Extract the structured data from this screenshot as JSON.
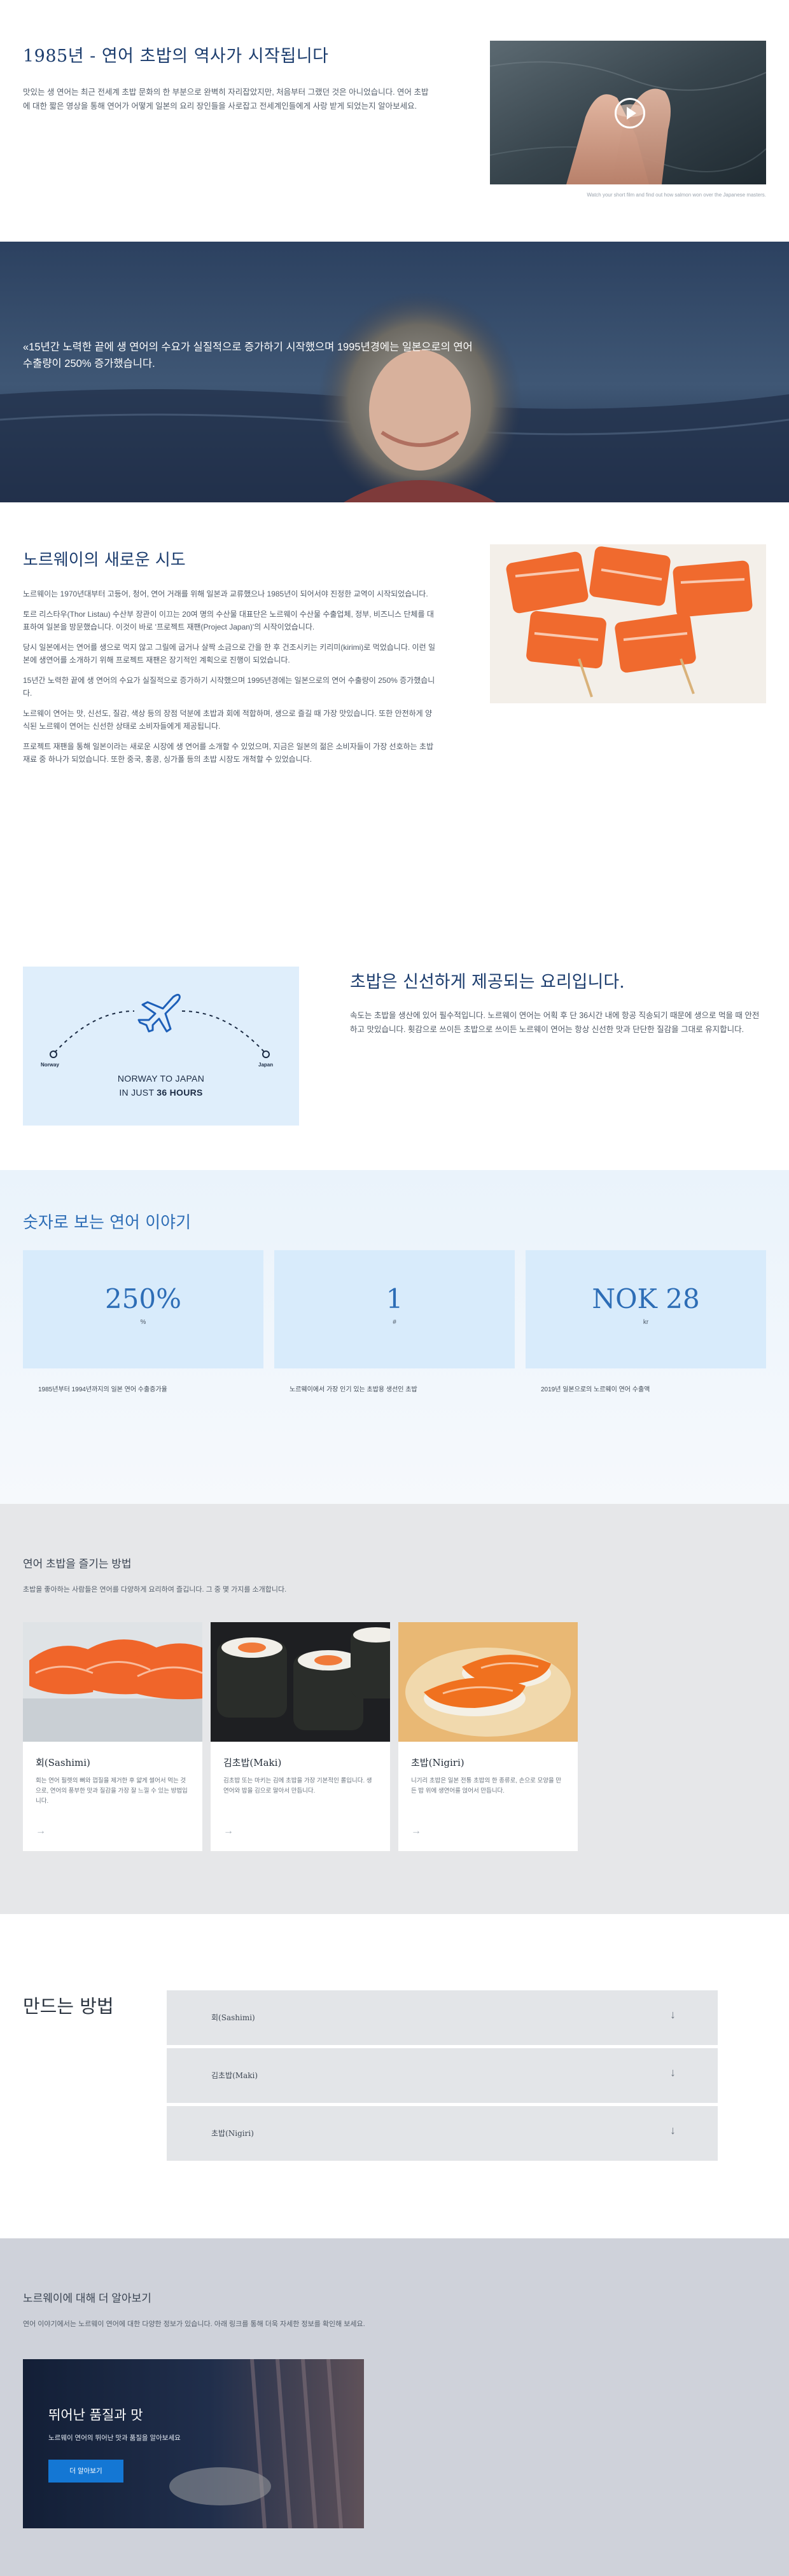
{
  "history": {
    "title": "1985년 - 연어 초밥의 역사가 시작됩니다",
    "body": "맛있는 생 연어는 최근 전세계 초밥 문화의 한 부분으로 완벽히 자리잡았지만, 처음부터 그랬던 것은 아니었습니다. 연어 초밥에 대한 짧은 영상을 통해 연어가 어떻게 일본의 요리 장인들을 사로잡고 전세계인들에게 사랑 받게 되었는지 알아보세요.",
    "video_caption": "Watch your short film and find out how salmon won over the Japanese masters."
  },
  "banner": {
    "quote": "«15년간 노력한 끝에 생 연어의 수요가 실질적으로 증가하기 시작했으며 1995년경에는 일본으로의 연어 수출량이 250% 증가했습니다."
  },
  "attempt": {
    "title": "노르웨이의 새로운 시도",
    "paragraphs": [
      "노르웨이는 1970년대부터 고등어, 청어, 연어 거래를 위해 일본과 교류했으나 1985년이 되어서야 진정한 교역이 시작되었습니다.",
      "토르 리스타우(Thor Listau) 수산부 장관이 이끄는 20여 명의 수산물 대표단은 노르웨이 수산물 수출업체, 정부, 비즈니스 단체를 대표하여 일본을 방문했습니다. 이것이 바로 '프로젝트 재팬(Project Japan)'의 시작이었습니다.",
      "당시 일본에서는 연어를 생으로 먹지 않고 그릴에 굽거나 살짝 소금으로 간을 한 후 건조시키는 키리미(kirimi)로 먹었습니다. 이런 일본에 생연어를 소개하기 위해 프로젝트 재팬은 장기적인 계획으로 진행이 되었습니다.",
      "15년간 노력한 끝에 생 연어의 수요가 실질적으로 증가하기 시작했으며 1995년경에는 일본으로의 연어 수출량이 250% 증가했습니다.",
      "노르웨이 연어는 맛, 신선도, 질감, 색상 등의 장점 덕분에 초밥과 회에 적합하며, 생으로 즐길 때 가장 맛있습니다. 또한 안전하게 양식된 노르웨이 연어는 신선한 상태로 소비자들에게 제공됩니다.",
      "프로젝트 재팬을 통해 일본이라는 새로운 시장에 생 연어를 소개할 수 있었으며, 지금은 일본의 젊은 소비자들이 가장 선호하는 초밥 재료 중 하나가 되었습니다. 또한 중국, 홍콩, 싱가폴 등의 초밥 시장도 개척할 수 있었습니다."
    ]
  },
  "fresh": {
    "route_from": "Norway",
    "route_to": "Japan",
    "route_line1": "NORWAY TO JAPAN",
    "route_line2_prefix": "IN JUST ",
    "route_line2_bold": "36 HOURS",
    "title": "초밥은 신선하게 제공되는 요리입니다.",
    "body": "속도는 초밥을 생산에 있어 필수적입니다. 노르웨이 연어는 어획 후 단 36시간 내에 항공 직송되기 때문에 생으로 먹을 때 안전하고 맛있습니다. 횟감으로 쓰이든 초밥으로 쓰이든 노르웨이 연어는 항상 신선한 맛과 단단한 질감을 그대로 유지합니다."
  },
  "stats": {
    "title": "숫자로 보는 연어 이야기",
    "items": [
      {
        "value": "250%",
        "unit": "%",
        "desc": "1985년부터 1994년까지의 일본 연어 수출증가율"
      },
      {
        "value": "1",
        "unit": "#",
        "desc": "노르웨이에서 가장 인기 있는 초밥용 생선인 초밥"
      },
      {
        "value": "NOK 28",
        "unit": "kr",
        "desc": "2019년 일본으로의 노르웨이 연어 수출액"
      }
    ]
  },
  "ways": {
    "title": "연어 초밥을 즐기는 방법",
    "subtitle": "초밥을 좋아하는 사람들은 연어를 다양하게 요리하여 즐깁니다. 그 중 몇 가지를 소개합니다.",
    "cards": [
      {
        "title": "회(Sashimi)",
        "desc": "회는 연어 필렛의 뼈와 껍질을 제거한 후 얇게 썰어서 먹는 것으로, 연어의 풍부한 맛과 질감을 가장 잘 느낄 수 있는 방법입니다.",
        "arrow": "→"
      },
      {
        "title": "김초밥(Maki)",
        "desc": "김초밥 또는 마키는 김에 초밥을 가장 기본적인 롤입니다. 생연어와 밥을 김으로 말아서 만듭니다.",
        "arrow": "→"
      },
      {
        "title": "초밥(Nigiri)",
        "desc": "니기리 초밥은 일본 전통 초밥의 한 종류로, 손으로 모양을 만든 밥 위에 생연어를 얹어서 만듭니다.",
        "arrow": "→"
      }
    ]
  },
  "make": {
    "title": "만드는 방법",
    "items": [
      {
        "label": "회(Sashimi)",
        "chev": "↓"
      },
      {
        "label": "김초밥(Maki)",
        "chev": "↓"
      },
      {
        "label": "초밥(Nigiri)",
        "chev": "↓"
      }
    ]
  },
  "more": {
    "title": "노르웨이에 대해 더 알아보기",
    "subtitle": "연어 이야기에서는 노르웨이 연어에 대한 다양한 정보가 있습니다. 아래 링크를 통해 더욱 자세한 정보를 확인해 보세요.",
    "promo_title": "뛰어난 품질과 맛",
    "promo_desc": "노르웨이 연어의 뛰어난 맛과 품질을 알아보세요",
    "promo_button": "더 알아보기"
  },
  "colors": {
    "accent": "#1c3d6e",
    "stat_blue": "#2d6db6",
    "button_blue": "#1477d4",
    "route_card": "#dfeefb"
  }
}
